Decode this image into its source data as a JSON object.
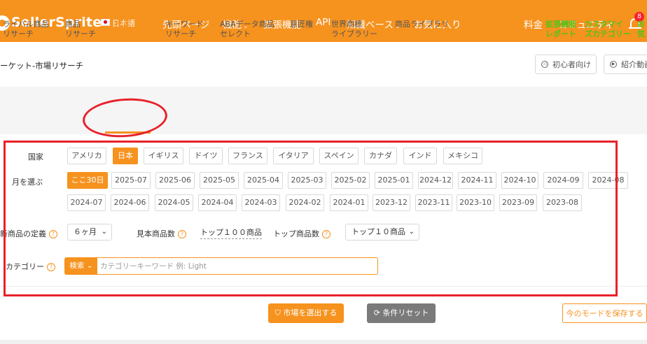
{
  "header": {
    "logo": "SellerSprite",
    "language": "日本語",
    "nav": [
      {
        "label": "先頭ページ",
        "chevron": false
      },
      {
        "label": "機能",
        "chevron": true
      },
      {
        "label": "拡張機能",
        "chevron": false
      },
      {
        "label": "API",
        "chevron": false
      },
      {
        "label": "知識ベース",
        "chevron": true
      },
      {
        "label": "お気に入り",
        "chevron": false
      },
      {
        "label": "料金",
        "chevron": false
      },
      {
        "label": "コミュニティ",
        "chevron": false
      }
    ],
    "notification_count": "8"
  },
  "page": {
    "title": "ーケット-市場リサーチ",
    "beginner_button": "初心者向け",
    "intro_button": "紹介動画"
  },
  "tabs": [
    {
      "label": "ライバル商品\nリサーチ"
    },
    {
      "label": "商品\nリサーチ"
    },
    {
      "label": "市場\nリサーチ",
      "active": true
    },
    {
      "label": "キーワード\nリサーチ"
    },
    {
      "label": "ABAデータ商品\nセレクト"
    },
    {
      "label": "意匠権"
    },
    {
      "label": "世界商標\nライブラリー"
    },
    {
      "label": "商品ライブラリ"
    },
    {
      "label": "拡張機能\nレポート",
      "highlight": true
    },
    {
      "label": "カスタマイ\nズカテゴリー",
      "highlight": true
    },
    {
      "label": "お気",
      "highlight": true
    }
  ],
  "filters": {
    "country_label": "国家",
    "countries": [
      "アメリカ",
      "日本",
      "イギリス",
      "ドイツ",
      "フランス",
      "イタリア",
      "スペイン",
      "カナダ",
      "インド",
      "メキシコ"
    ],
    "selected_country": "日本",
    "month_label": "月を選ぶ",
    "months_row1": [
      "ここ30日",
      "2025-07",
      "2025-06",
      "2025-05",
      "2025-04",
      "2025-03",
      "2025-02",
      "2025-01",
      "2024-12",
      "2024-11",
      "2024-10",
      "2024-09",
      "2024-08"
    ],
    "months_row2": [
      "2024-07",
      "2024-06",
      "2024-05",
      "2024-04",
      "2024-03",
      "2024-02",
      "2024-01",
      "2023-12",
      "2023-11",
      "2023-10",
      "2023-09",
      "2023-08"
    ],
    "selected_month": "ここ30日",
    "new_product_label": "新商品の定義",
    "new_product_value": "６ヶ月",
    "sample_label": "見本商品数",
    "sample_value": "トップ１００商品",
    "top_label": "トップ商品数",
    "top_value": "トップ１０商品",
    "category_label": "カテゴリー",
    "search_button": "検索",
    "search_placeholder": "カテゴリーキーワード 例: Light"
  },
  "actions": {
    "select_market": "市場を選出する",
    "reset": "条件リセット",
    "save_mode": "今のモードを保存する"
  },
  "colors": {
    "brand": "#f6921e",
    "annotation": "#e8212a",
    "highlight_tab": "#52c41a",
    "reset_button": "#7a7a7a"
  }
}
